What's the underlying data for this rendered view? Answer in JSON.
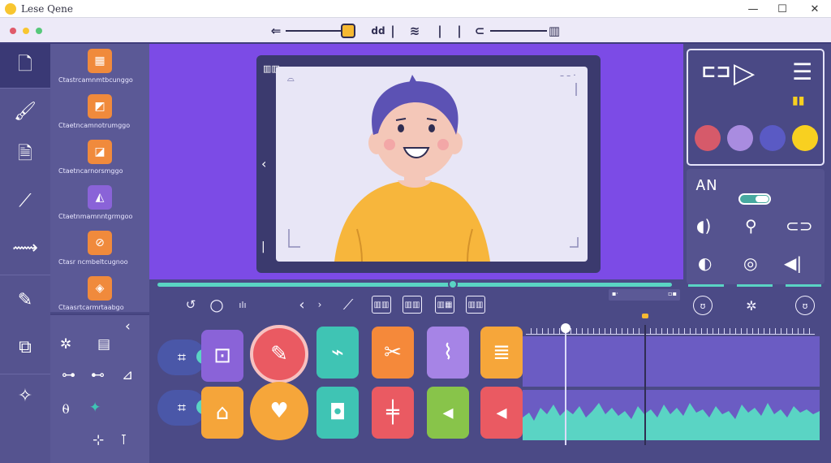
{
  "window": {
    "title": "Lese Qene",
    "minimize": "—",
    "maximize": "☐",
    "close": "✕"
  },
  "toolbar": {
    "colors": [
      "#e05a6a",
      "#f8c630",
      "#56c87a"
    ],
    "back_icon": "⇐",
    "cut_label": "dd",
    "divider": "|",
    "ripple_icon": "≋",
    "audio_icon": "⊂",
    "trash_icon": "▥"
  },
  "sidebar": {
    "items": [
      {
        "icon": "document-icon",
        "glyph": "🗋"
      },
      {
        "icon": "brush-icon",
        "glyph": "🖌"
      },
      {
        "icon": "file-icon",
        "glyph": "🗎"
      },
      {
        "icon": "stroke-icon",
        "glyph": "⟋"
      },
      {
        "icon": "scribble-icon",
        "glyph": "⟿"
      },
      {
        "icon": "pin-icon",
        "glyph": "✎"
      },
      {
        "icon": "film-icon",
        "glyph": "⧉"
      },
      {
        "icon": "star-map-icon",
        "glyph": "✧"
      }
    ]
  },
  "assets": {
    "items": [
      {
        "label": "Ctastrcamnmtbcunggo",
        "color": "#f08a3c",
        "glyph": "▦"
      },
      {
        "label": "Ctaetncamnotrumggo",
        "color": "#f08a3c",
        "glyph": "◩"
      },
      {
        "label": "Ctaetncarnorsmggo",
        "color": "#f08a3c",
        "glyph": "◪"
      },
      {
        "label": "Ctaetnmamnntgrmgoo",
        "color": "#f08a3c",
        "glyph": "◭"
      },
      {
        "label": "Ctasr ncmbeltcugnoo",
        "color": "#f08a3c",
        "glyph": "⊘"
      },
      {
        "label": "Ctaasrtcarmrtaabgo",
        "color": "#f08a3c",
        "glyph": "◈"
      }
    ]
  },
  "effects": {
    "collapse": "‹",
    "items": [
      "✲",
      "▤",
      "⊶",
      "⊷",
      "⊿",
      "⍬",
      "✦",
      "⊹",
      "⊺"
    ]
  },
  "preview": {
    "corner_icon": "⌓",
    "dots": "– – ·",
    "nav_left": "‹",
    "char_hair": "#5c52b4",
    "char_shirt": "#f7b63c",
    "char_skin": "#f4c7b8"
  },
  "transport": {
    "loop_icon": "↺",
    "record_icon": "○",
    "marker_label": "ılı",
    "prev_icon": "‹",
    "next_icon": "›",
    "ruler_icon": "⟋",
    "boxes": [
      "▥▥",
      "▥▥",
      "▥▦",
      "▥▥"
    ],
    "mini_bar_left": "▪·",
    "mini_bar_right": "▫▪"
  },
  "effects_panel": {
    "clip_icon": "⊏⊐",
    "play_icon": "▷",
    "list_icon": "☰",
    "small_icon": "▮▮",
    "swatches": [
      "#d65a6a",
      "#a98ce0",
      "#5a5ac4",
      "#f8d020"
    ]
  },
  "audio_panel": {
    "label": "ᎪN",
    "icons": [
      "◖)",
      "⚲",
      "⊂⊃",
      "◐",
      "◎",
      "◀|"
    ]
  },
  "right_bar": {
    "icons": [
      "ʊ",
      "✲",
      "ʊ"
    ]
  },
  "timeline": {
    "track1": [
      {
        "name": "lead-clip",
        "glyph": "⌗"
      },
      {
        "name": "crop-clip",
        "glyph": "⊡",
        "color": "#8a63d8"
      },
      {
        "name": "pen-clip",
        "glyph": "✎",
        "color": "#ea5a62",
        "round": true
      },
      {
        "name": "hand-clip",
        "glyph": "⌁",
        "color": "#3fc4b4"
      },
      {
        "name": "scissors-clip",
        "glyph": "✂",
        "color": "#f5893a"
      },
      {
        "name": "wing-clip",
        "glyph": "⌇",
        "color": "#a684e6"
      },
      {
        "name": "stack-clip",
        "glyph": "≣",
        "color": "#f6a63a"
      }
    ],
    "track2": [
      {
        "name": "lead-clip-2",
        "glyph": "⌗"
      },
      {
        "name": "tag-clip",
        "glyph": "⌂",
        "color": "#f5a53a"
      },
      {
        "name": "heart-clip",
        "glyph": "♥",
        "color": "#f6a63a",
        "round": true
      },
      {
        "name": "bag-clip",
        "glyph": "◘",
        "color": "#3fc4b4"
      },
      {
        "name": "plus-clip",
        "glyph": "╪",
        "color": "#ea5a62"
      },
      {
        "name": "volume-clip",
        "glyph": "◂",
        "color": "#88c44a"
      },
      {
        "name": "mute-clip",
        "glyph": "◂",
        "color": "#ea5a62"
      }
    ]
  }
}
